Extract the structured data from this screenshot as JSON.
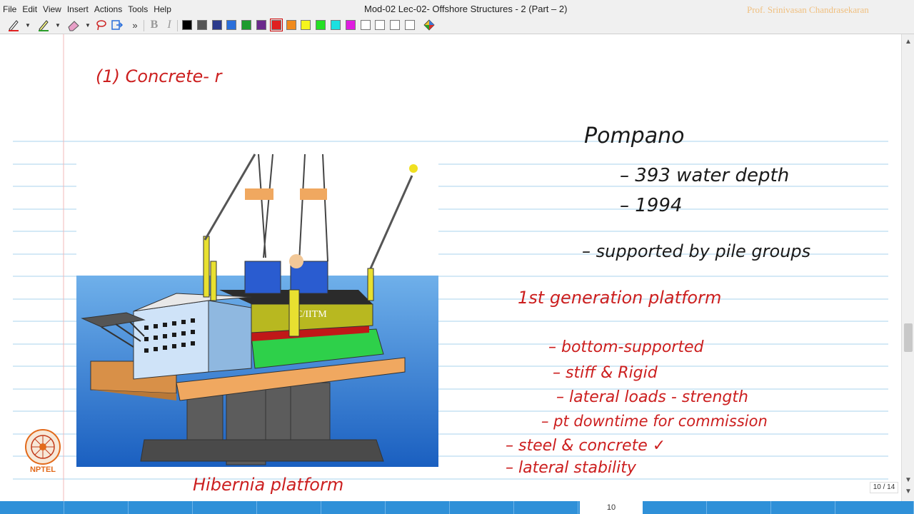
{
  "menu": [
    "File",
    "Edit",
    "View",
    "Insert",
    "Actions",
    "Tools",
    "Help"
  ],
  "window_title": "Mod-02 Lec-02- Offshore Structures - 2 (Part – 2)",
  "watermark": "Prof. Srinivasan Chandrasekaran",
  "toolbar": {
    "overflow_label": "»",
    "bold_label": "B",
    "italic_label": "I",
    "colors": [
      "#000000",
      "#555555",
      "#2b3a8c",
      "#2a6fdb",
      "#1e9b2e",
      "#6b2a8c",
      "#e02020",
      "#f08a1c",
      "#f5f51c",
      "#25e025",
      "#1ce0e0",
      "#e01ce0",
      "#ffffff",
      "#ffffff",
      "#ffffff",
      "#ffffff"
    ],
    "selected_color": "#e02020"
  },
  "notes": {
    "top_left": "(1)   Concrete-   r",
    "caption": "Hibernia platform",
    "pompano": "Pompano",
    "water_depth": "–  393 water depth",
    "year": "–  1994",
    "supported": "– supported by pile groups",
    "first_gen": "1st generation platform",
    "bullets": [
      "–  bottom-supported",
      "–  stiff & Rigid",
      "–  lateral loads - strength",
      "–  pt downtime for commission",
      "–  steel & concrete        ✓",
      "–  lateral stability"
    ],
    "image_label": "SC/IITM"
  },
  "page_indicator": "10 / 14",
  "page_number": "10",
  "logo_text": "NPTEL",
  "ink_color": "#cc1f1f",
  "rule_color": "#a8d3ec"
}
